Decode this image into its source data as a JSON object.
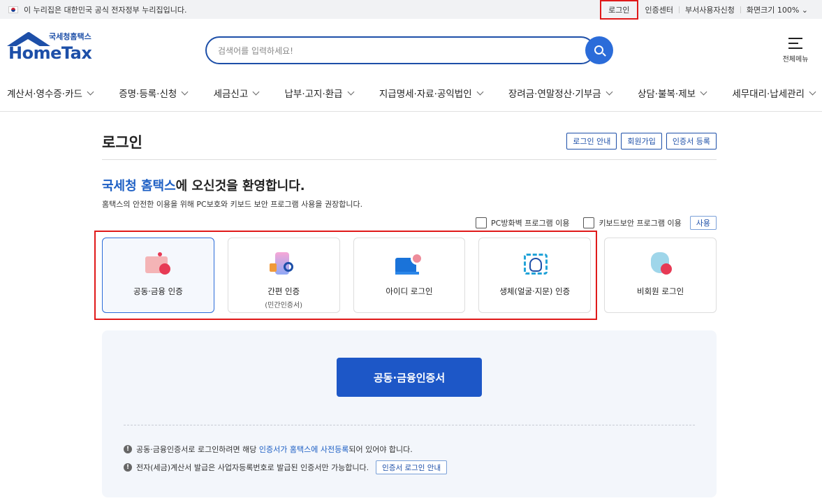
{
  "govbar": {
    "notice": "이 누리집은 대한민국 공식 전자정부 누리집입니다.",
    "links": [
      "로그인",
      "인증센터",
      "부서사용자신청",
      "화면크기 100%"
    ]
  },
  "header": {
    "logo_sub": "국세청홈택스",
    "logo_main": "HomeTax",
    "search_placeholder": "검색어를 입력하세요!",
    "allmenu_label": "전체메뉴"
  },
  "nav": [
    "계산서·영수증·카드",
    "증명·등록·신청",
    "세금신고",
    "납부·고지·환급",
    "지급명세·자료·공익법인",
    "장려금·연말정산·기부금",
    "상담·불복·제보",
    "세무대리·납세관리"
  ],
  "page": {
    "title": "로그인",
    "buttons": [
      "로그인 안내",
      "회원가입",
      "인증서 등록"
    ],
    "welcome_hl": "국세청 홈택스",
    "welcome_rest": "에 오신것을 환영합니다.",
    "note": "홈택스의 안전한 이용을 위해 PC보호와 키보드 보안 프로그램 사용을 권장합니다.",
    "security": {
      "firewall": "PC방화벽 프로그램 이용",
      "keyboard": "키보드보안 프로그램 이용",
      "use": "사용"
    }
  },
  "cards": [
    {
      "label": "공동·금융 인증",
      "sub": ""
    },
    {
      "label": "간편 인증",
      "sub": "(민간인증서)"
    },
    {
      "label": "아이디 로그인",
      "sub": ""
    },
    {
      "label": "생체(얼굴·지문) 인증",
      "sub": ""
    },
    {
      "label": "비회원 로그인",
      "sub": ""
    }
  ],
  "panel": {
    "main_button": "공동·금융인증서",
    "info1_pre": "공동·금융인증서로 로그인하려면 해당 ",
    "info1_link": "인증서가 홈택스에 사전등록",
    "info1_post": "되어 있어야 합니다.",
    "info2": "전자(세금)계산서 발급은 사업자등록번호로 발급된 인증서만 가능합니다.",
    "info2_button": "인증서 로그인 안내"
  },
  "colors": {
    "brand": "#1d4fa8",
    "primary_button": "#1d57c7",
    "highlight_frame": "#e01919"
  }
}
